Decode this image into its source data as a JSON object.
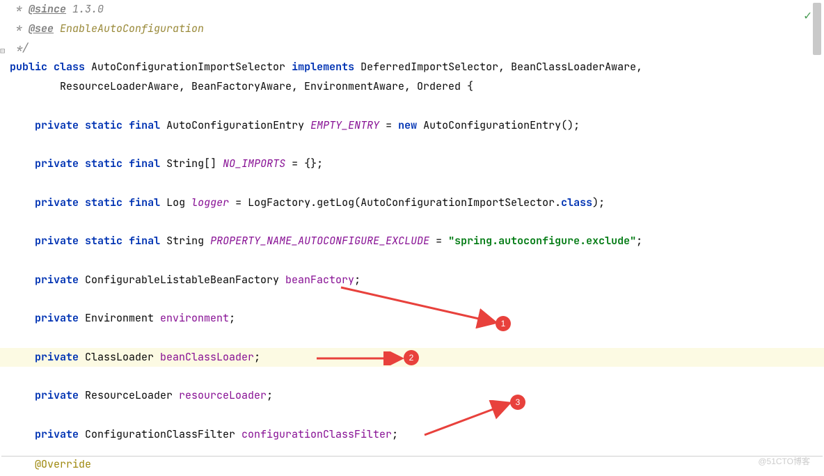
{
  "javadoc": {
    "since_tag": "@since",
    "since_value": " 1.3.0",
    "see_tag": "@see",
    "see_link": "EnableAutoConfiguration"
  },
  "class_decl": {
    "pub": "public",
    "cls": "class",
    "name": " AutoConfigurationImportSelector ",
    "impl": "implements",
    "rest1": " DeferredImportSelector, BeanClassLoaderAware,",
    "rest2": "        ResourceLoaderAware, BeanFactoryAware, EnvironmentAware, Ordered {"
  },
  "fields": {
    "f1": {
      "priv": "private",
      "stat": "static",
      "fin": "final",
      "type": " AutoConfigurationEntry ",
      "name": "EMPTY_ENTRY",
      "eq": " = ",
      "newkw": "new",
      "rest": " AutoConfigurationEntry();"
    },
    "f2": {
      "priv": "private",
      "stat": "static",
      "fin": "final",
      "type": " String[] ",
      "name": "NO_IMPORTS",
      "rest": " = {};"
    },
    "f3": {
      "priv": "private",
      "stat": "static",
      "fin": "final",
      "type": " Log ",
      "name": "logger",
      "eq": " = ",
      "call": "LogFactory.getLog(AutoConfigurationImportSelector.",
      "classkw": "class",
      "end": ");"
    },
    "f4": {
      "priv": "private",
      "stat": "static",
      "fin": "final",
      "type": " String ",
      "name": "PROPERTY_NAME_AUTOCONFIGURE_EXCLUDE",
      "eq": " = ",
      "str": "\"spring.autoconfigure.exclude\"",
      "end": ";"
    },
    "f5": {
      "priv": "private",
      "type": " ConfigurableListableBeanFactory ",
      "name": "beanFactory",
      "end": ";"
    },
    "f6": {
      "priv": "private",
      "type": " Environment ",
      "name": "environment",
      "end": ";"
    },
    "f7": {
      "priv": "private",
      "type": " ClassLoader ",
      "name": "beanClassLoader",
      "end": ";"
    },
    "f8": {
      "priv": "private",
      "type": " ResourceLoader ",
      "name": "resourceLoader",
      "end": ";"
    },
    "f9": {
      "priv": "private",
      "type": " ConfigurationClassFilter ",
      "name": "configurationClassFilter",
      "end": ";"
    }
  },
  "override": "@Override",
  "star": " * ",
  "star_end": " */",
  "indent": "    ",
  "badges": {
    "b1": "1",
    "b2": "2",
    "b3": "3"
  },
  "watermark": "@51CTO博客"
}
